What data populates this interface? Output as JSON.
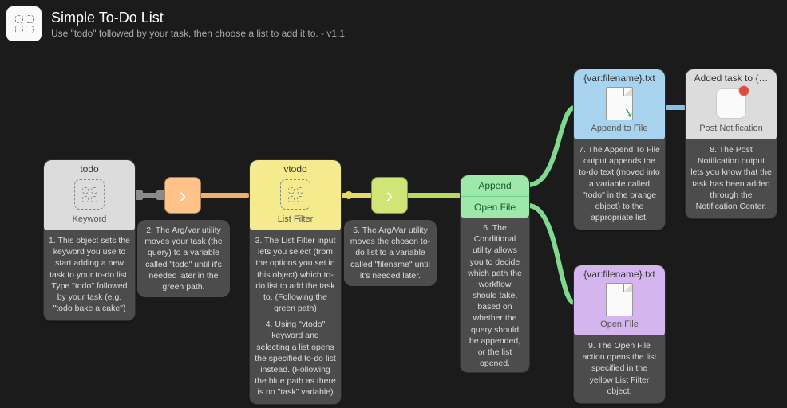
{
  "header": {
    "title": "Simple To-Do List",
    "subtitle": "Use \"todo\" followed by your task, then choose a list to add it to. - v1.1"
  },
  "nodes": {
    "keyword": {
      "title": "todo",
      "caption": "Keyword",
      "desc": "1. This object sets the keyword you use to start adding a new task to your to-do list. Type \"todo\" followed by your task (e.g. \"todo bake a cake\")"
    },
    "argvar1": {
      "desc": "2. The Arg/Var utility moves your task (the query) to a variable called \"todo\" until it's needed later in the green path."
    },
    "listfilter": {
      "title": "vtodo",
      "caption": "List Filter",
      "desc3": "3. The List Filter input lets you select (from the options you set in this object) which to-do list to add the task to. (Following the green path)",
      "desc4": "4. Using \"vtodo\" keyword and selecting a list opens the specified to-do list instead. (Following the blue path as there is no \"task\" variable)"
    },
    "argvar2": {
      "desc": "5. The Arg/Var utility moves the chosen to-do list to a variable called \"filename\" until it's needed later."
    },
    "conditional": {
      "rowA": "Append",
      "rowB": "Open File",
      "desc": "6. The Conditional utility allows you to decide which path the workflow should take, based on whether the query should be appended, or the list opened."
    },
    "append": {
      "title": "{var:filename}.txt",
      "caption": "Append to File",
      "desc": "7. The Append To File output appends the to-do text (moved into a variable called \"todo\" in the orange object) to the appropriate list."
    },
    "notify": {
      "title": "Added task to {…",
      "caption": "Post Notification",
      "desc": "8. The Post Notification output lets you know that the task has been added through the Notification Center."
    },
    "openfile": {
      "title": "{var:filename}.txt",
      "caption": "Open File",
      "desc": "9. The Open File action opens the list specified in the yellow List Filter object."
    }
  }
}
